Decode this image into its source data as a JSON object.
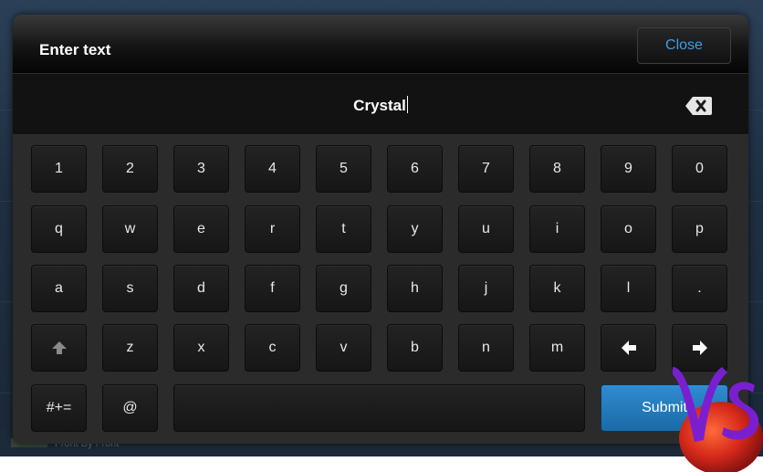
{
  "backdrop": {
    "footer_label": "Front By Front"
  },
  "dialog": {
    "title": "Enter text",
    "close_label": "Close",
    "input_value": "Crystal"
  },
  "keyboard": {
    "row1": [
      "1",
      "2",
      "3",
      "4",
      "5",
      "6",
      "7",
      "8",
      "9",
      "0"
    ],
    "row2": [
      "q",
      "w",
      "e",
      "r",
      "t",
      "y",
      "u",
      "i",
      "o",
      "p"
    ],
    "row3": [
      "a",
      "s",
      "d",
      "f",
      "g",
      "h",
      "j",
      "k",
      "l",
      "."
    ],
    "row4_letters": [
      "z",
      "x",
      "c",
      "v",
      "b",
      "n",
      "m"
    ],
    "symbols_label": "#+=",
    "at_label": "@",
    "submit_label": "Submit"
  },
  "colors": {
    "accent": "#3c9fe6",
    "submit": "#1f78bb"
  },
  "icons": {
    "backspace": "backspace-icon",
    "shift": "shift-icon",
    "left_arrow": "arrow-left-icon",
    "right_arrow": "arrow-right-icon"
  }
}
